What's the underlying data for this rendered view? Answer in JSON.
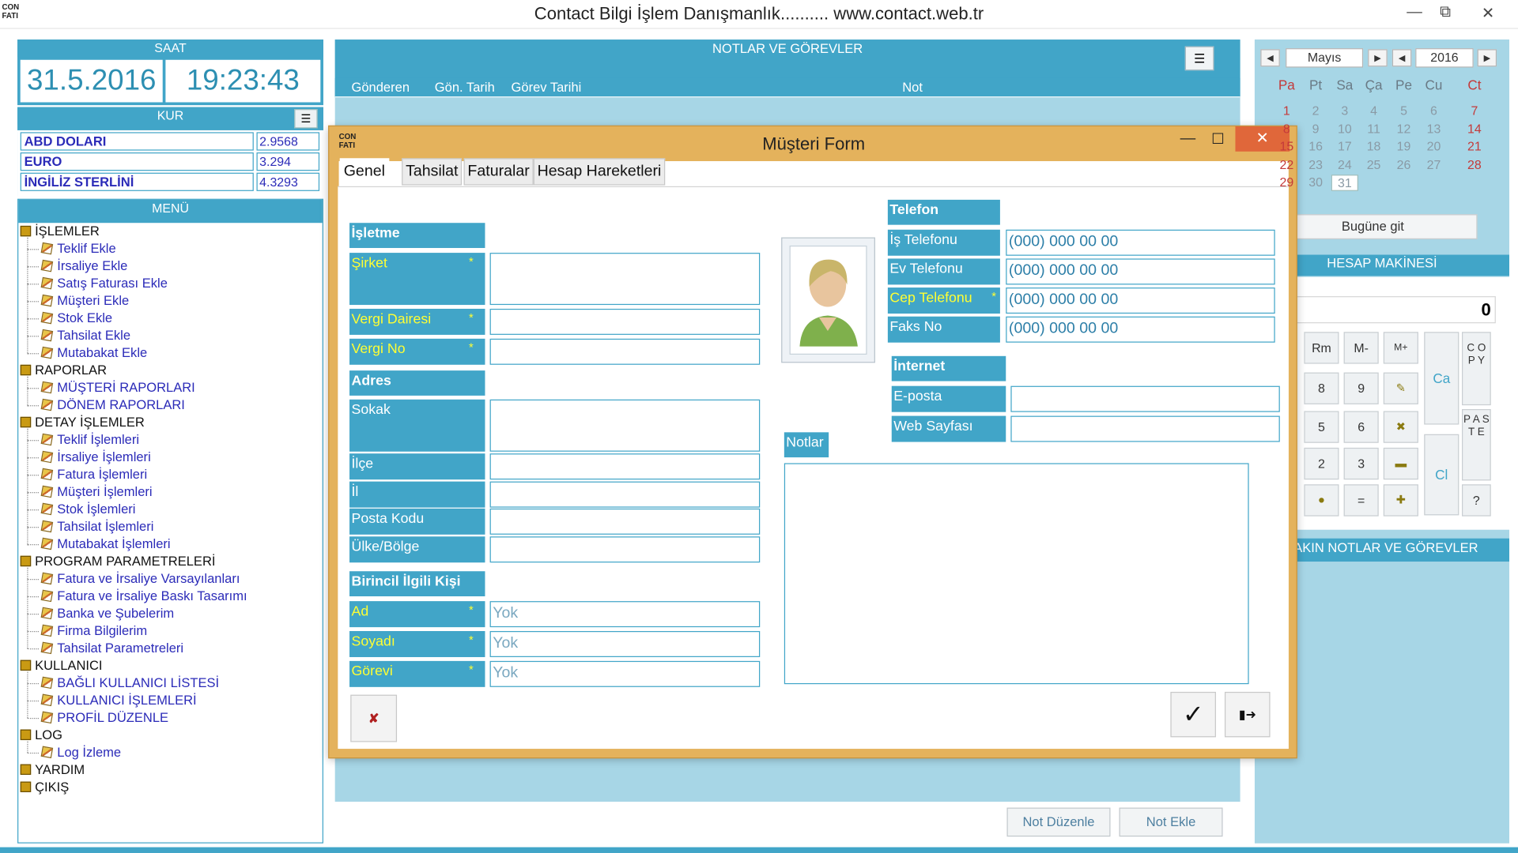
{
  "window": {
    "title": "Contact Bilgi İşlem Danışmanlık.......... www.contact.web.tr",
    "logo_text": "CON FATI"
  },
  "clock": {
    "header": "SAAT",
    "date": "31.5.2016",
    "time": "19:23:43"
  },
  "currency": {
    "header": "KUR",
    "rows": [
      {
        "name": "ABD DOLARI",
        "value": "2.9568"
      },
      {
        "name": "EURO",
        "value": "3.294"
      },
      {
        "name": "İNGİLİZ STERLİNİ",
        "value": "4.3293"
      }
    ]
  },
  "menu": {
    "header": "MENÜ",
    "groups": [
      {
        "label": "İŞLEMLER",
        "items": [
          "Teklif Ekle",
          "İrsaliye Ekle",
          "Satış Faturası Ekle",
          "Müşteri Ekle",
          "Stok Ekle",
          "Tahsilat Ekle",
          "Mutabakat Ekle"
        ]
      },
      {
        "label": "RAPORLAR",
        "items": [
          "MÜŞTERİ RAPORLARI",
          "DÖNEM RAPORLARI"
        ]
      },
      {
        "label": "DETAY İŞLEMLER",
        "items": [
          "Teklif İşlemleri",
          "İrsaliye İşlemleri",
          "Fatura İşlemleri",
          "Müşteri İşlemleri",
          "Stok İşlemleri",
          "Tahsilat İşlemleri",
          "Mutabakat İşlemleri"
        ]
      },
      {
        "label": "PROGRAM PARAMETRELERİ",
        "items": [
          "Fatura ve İrsaliye Varsayılanları",
          "Fatura ve İrsaliye Baskı Tasarımı",
          "Banka ve Şubelerim",
          "Firma Bilgilerim",
          "Tahsilat Parametreleri"
        ]
      },
      {
        "label": "KULLANICI",
        "items": [
          "BAĞLI KULLANICI LİSTESİ",
          "KULLANICI İŞLEMLERİ",
          "PROFİL DÜZENLE"
        ]
      },
      {
        "label": "LOG",
        "items": [
          "Log İzleme"
        ]
      },
      {
        "label": "YARDIM",
        "items": []
      },
      {
        "label": "ÇIKIŞ",
        "items": []
      }
    ]
  },
  "notes_panel": {
    "header": "NOTLAR VE GÖREVLER",
    "columns": [
      "Gönderen",
      "Gön. Tarih",
      "Görev Tarihi",
      "Not"
    ],
    "buttons": {
      "edit": "Not Düzenle",
      "add": "Not Ekle"
    }
  },
  "calendar": {
    "month": "Mayıs",
    "year": "2016",
    "weekdays": [
      "Pa",
      "Pt",
      "Sa",
      "Ça",
      "Pe",
      "Cu",
      "Ct"
    ],
    "weeks": [
      [
        "1",
        "2",
        "3",
        "4",
        "5",
        "6",
        "7"
      ],
      [
        "8",
        "9",
        "10",
        "11",
        "12",
        "13",
        "14"
      ],
      [
        "15",
        "16",
        "17",
        "18",
        "19",
        "20",
        "21"
      ],
      [
        "22",
        "23",
        "24",
        "25",
        "26",
        "27",
        "28"
      ],
      [
        "29",
        "30",
        "31",
        "",
        "",
        "",
        ""
      ]
    ],
    "today_button": "Bugüne git"
  },
  "calculator": {
    "header": "HESAP MAKİNESİ",
    "display": "0",
    "buttons": {
      "rm": "Rm",
      "mminus": "M-",
      "mplus": "M+",
      "n8": "8",
      "n9": "9",
      "n5": "5",
      "n6": "6",
      "n2": "2",
      "n3": "3",
      "eq": "=",
      "ca": "Ca",
      "ci": "Cl",
      "copy": "C O P Y",
      "paste": "P A S T E",
      "help": "?"
    }
  },
  "upcoming": {
    "header": "YAKIN NOTLAR VE GÖREVLER"
  },
  "dialog": {
    "title": "Müşteri Form",
    "logo_text": "CON FATI",
    "tabs": [
      "Genel",
      "Tahsilat",
      "Faturalar",
      "Hesap Hareketleri"
    ],
    "sections": {
      "isletme": "İşletme",
      "adres": "Adres",
      "ilgili": "Birincil İlgili Kişi",
      "telefon": "Telefon",
      "internet": "İnternet",
      "notlar": "Notlar"
    },
    "labels": {
      "sirket": "Şirket",
      "vergi_dairesi": "Vergi Dairesi",
      "vergi_no": "Vergi No",
      "sokak": "Sokak",
      "ilce": "İlçe",
      "il": "İl",
      "posta_kodu": "Posta Kodu",
      "ulke": "Ülke/Bölge",
      "ad": "Ad",
      "soyadi": "Soyadı",
      "gorevi": "Görevi",
      "is_tel": "İş Telefonu",
      "ev_tel": "Ev Telefonu",
      "cep_tel": "Cep Telefonu",
      "faks": "Faks No",
      "eposta": "E-posta",
      "web": "Web Sayfası"
    },
    "required_mark": "*",
    "values": {
      "ad": "Yok",
      "soyadi": "Yok",
      "gorevi": "Yok",
      "is_tel": "(000) 000 00 00",
      "ev_tel": "(000) 000 00 00",
      "cep_tel": "(000) 000 00 00",
      "faks": "(000) 000 00 00"
    }
  }
}
